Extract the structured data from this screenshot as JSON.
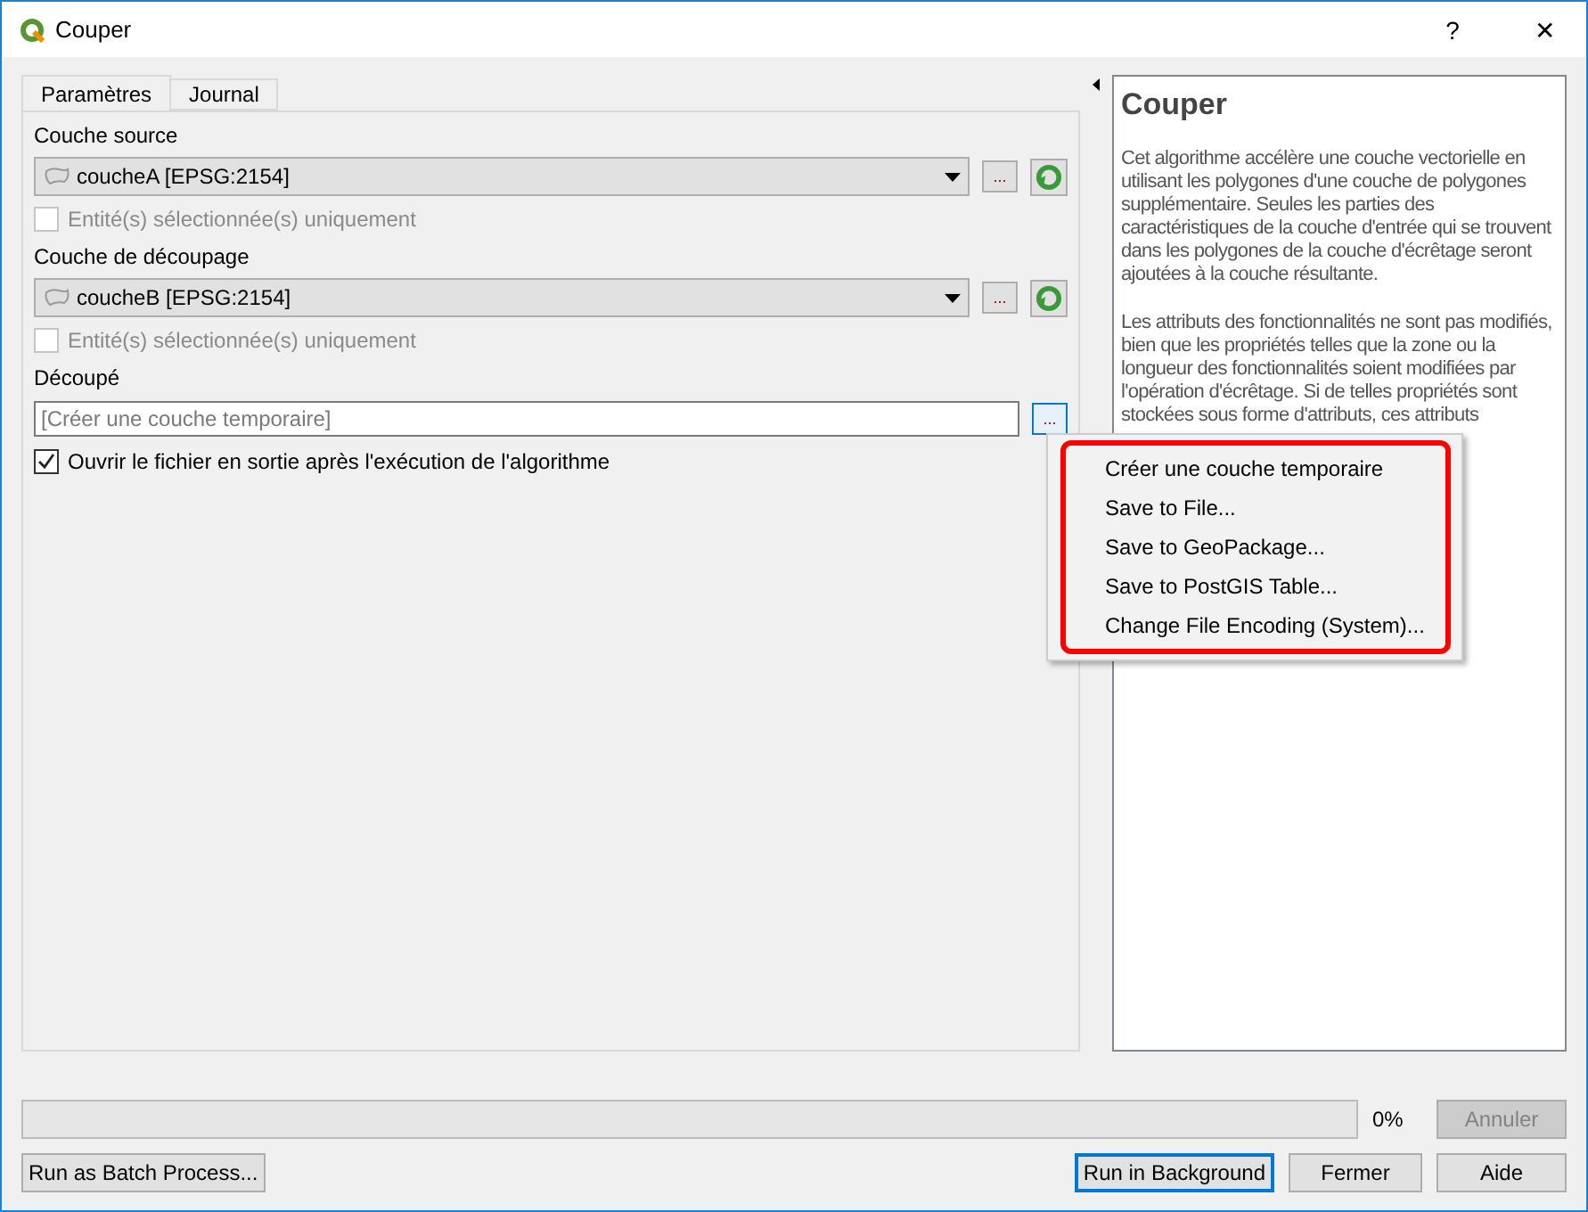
{
  "window": {
    "title": "Couper",
    "help_button": "?",
    "close_button": "✕"
  },
  "tabs": [
    {
      "label": "Paramètres",
      "selected": true
    },
    {
      "label": "Journal",
      "selected": false
    }
  ],
  "params": [
    {
      "kind": "layer",
      "label": "Couche source",
      "value": "coucheA [EPSG:2154]",
      "browse": "...",
      "checkbox": {
        "label": "Entité(s) sélectionnée(s) uniquement",
        "checked": false,
        "disabled": true
      }
    },
    {
      "kind": "layer",
      "label": "Couche de découpage",
      "value": "coucheB [EPSG:2154]",
      "browse": "...",
      "checkbox": {
        "label": "Entité(s) sélectionnée(s) uniquement",
        "checked": false,
        "disabled": true
      }
    },
    {
      "kind": "output",
      "label": "Découpé",
      "placeholder": "[Créer une couche temporaire]",
      "browse": "...",
      "checkbox": {
        "label": "Ouvrir le fichier en sortie après l'exécution de l'algorithme",
        "checked": true,
        "disabled": false
      }
    }
  ],
  "menu": {
    "items": [
      "Créer une couche temporaire",
      "Save to File...",
      "Save to GeoPackage...",
      "Save to PostGIS Table...",
      "Change File Encoding (System)..."
    ]
  },
  "help": {
    "title": "Couper",
    "paragraphs": [
      "Cet algorithme accélère une couche vectorielle en utilisant les polygones d'une couche de polygones supplémentaire. Seules les parties des caractéristiques de la couche d'entrée qui se trouvent dans les polygones de la couche d'écrêtage seront ajoutées à la couche résultante.",
      "Les attributs des fonctionnalités ne sont pas modifiés, bien que les propriétés telles que la zone ou la longueur des fonctionnalités soient modifiées par l'opération d'écrêtage. Si de telles propriétés sont stockées sous forme d'attributs, ces attributs"
    ]
  },
  "progress": {
    "level": 0,
    "reading": "0%"
  },
  "buttons": [
    {
      "label": "Annuler",
      "disabled": true,
      "focused": false
    },
    {
      "label": "Run as Batch Process...",
      "disabled": false,
      "focused": false
    },
    {
      "label": "Run in Background",
      "disabled": false,
      "focused": true
    },
    {
      "label": "Fermer",
      "disabled": false,
      "focused": false
    },
    {
      "label": "Aide",
      "disabled": false,
      "focused": false
    }
  ]
}
